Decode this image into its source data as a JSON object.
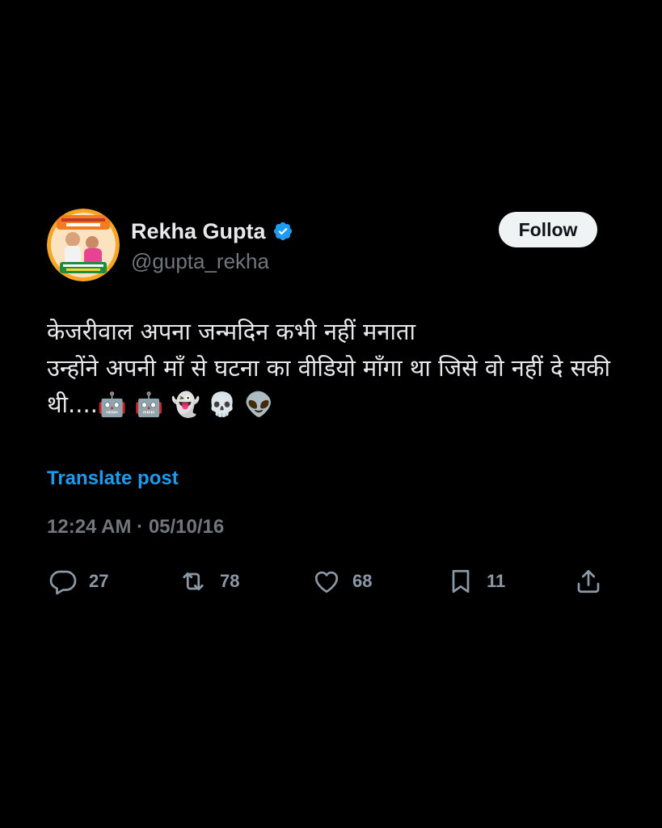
{
  "tweet": {
    "display_name": "Rekha Gupta",
    "handle": "@gupta_rekha",
    "follow_label": "Follow",
    "text": "केजरीवाल अपना जन्मदिन कभी नहीं मनाता\nउन्होंने अपनी माँ से घटना का वीडियो माँगा था जिसे वो नहीं दे सकी थी....🤖 🤖 👻 💀 👽",
    "translate_label": "Translate post",
    "timestamp": "12:24 AM · 05/10/16",
    "metrics": {
      "replies": "27",
      "reposts": "78",
      "likes": "68",
      "bookmarks": "11"
    }
  },
  "icons": {
    "verified": "verified-badge-icon",
    "reply": "comment-bubble-icon",
    "repost": "repost-arrows-icon",
    "like": "heart-icon",
    "bookmark": "bookmark-icon",
    "share": "share-upload-icon"
  },
  "colors": {
    "background": "#000000",
    "text_primary": "#e7e9ea",
    "text_secondary": "#71767b",
    "accent_blue": "#1d9bf0",
    "follow_bg": "#eff3f4"
  }
}
